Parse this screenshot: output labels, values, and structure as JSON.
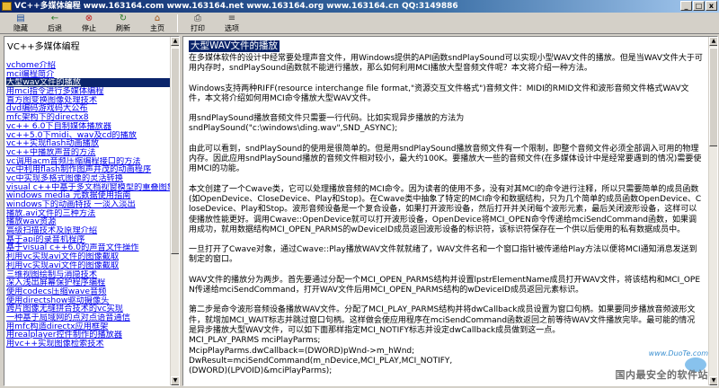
{
  "window": {
    "title": "VC++多媒体编程   www.163164.com  www.163164.net  www.163164.org  www.163164.cn QQ:3149886",
    "min_glyph": "_",
    "max_glyph": "□",
    "close_glyph": "x"
  },
  "toolbar": {
    "items": [
      {
        "label": "隐藏",
        "icon": "hide-icon",
        "glyph": "▤"
      },
      {
        "label": "后退",
        "icon": "back-icon",
        "glyph": "←"
      },
      {
        "label": "停止",
        "icon": "stop-icon",
        "glyph": "⊗"
      },
      {
        "label": "刷新",
        "icon": "refresh-icon",
        "glyph": "↻"
      },
      {
        "label": "主页",
        "icon": "home-icon",
        "glyph": "⌂"
      },
      {
        "label": "打印",
        "icon": "print-icon",
        "glyph": "⎙"
      },
      {
        "label": "选项",
        "icon": "options-icon",
        "glyph": "≡"
      }
    ]
  },
  "sidebar": {
    "title": "VC++多媒体编程",
    "items": [
      "vchome介绍",
      "mci编程简介",
      "大型wav文件的播放",
      "用mci指令进行多媒体编程",
      "直方图变换图像处理技术",
      "dvd编码游戏码大公布",
      "mfc架构下的directx8",
      "vc++ 6.0下自制媒体播放器",
      "vc++5.0下midi、wav及cd的播放",
      "vc++实现flash动画播放",
      "vc++中播放声音的方法",
      "vc调用acm音频压缩编程接口的方法",
      "vc中利用flash制作图声并茂的动画程序",
      "vc中实现多格式图像的灵活转换",
      "visual c++中基于多文档视窗模型的重叠图象",
      "windows media 元数据使用指南",
      "windows下的动画特技 一淡入淡出",
      "播放.avi文件的三种方法",
      "播放wav资源",
      "高级扫描技术及原理介绍",
      "基于api的录音机程序",
      "基于visual c++6.0的声音文件操作",
      "利用vc实现avi文件的图像截取",
      "利用vc实现avi文件的图像截取",
      "三维视图绘制与消隐技术",
      "深入浅出屏幕保护程序编程",
      "使用codecs压缩wave音频",
      "使用directshow驱动摄像头",
      "跨片图像无缝拼合技术的vc实现",
      "一种基于局域网的点对点语音通信",
      "用mfc构造directx应用框架",
      "用realplayer控件制作的播放器",
      "用vc++实现图像检索技术"
    ],
    "active_index": 2
  },
  "article": {
    "title": "大型WAV文件的播放",
    "paragraphs": [
      "在多媒体软件的设计中经常要处理声音文件，用Windows提供的API函数sndPlaySound可以实现小型WAV文件的播放。但是当WAV文件大于可用内存时，sndPlaySound函数就不能进行播放，那么如何利用MCI播放大型音频文件呢？本文将介绍一种方法。",
      "Windows支持两种RIFF(resource interchange file format,\"资源交互文件格式\")音频文件：MIDI的RMID文件和波形音频文件格式WAV文件，本文将介绍如何用MCI命令播放大型WAV文件。",
      "用sndPlaySound播放音频文件只需要一行代码。比如实现异步播放的方法为\nsndPlaySound(\"c:\\windows\\ding.wav\",SND_ASYNC);",
      "由此可以看到，sndPlaySound的使用是很简单的。但是用sndPlaySound播放音频文件有一个限制，即整个音频文件必须全部调入可用的物理内存。因此应用sndPlaySound播放的音频文件相对较小，最大约100K。要播放大一些的音频文件(在多媒体设计中是经常要遇到的情况)需要使用MCI的功能。",
      "本文创建了一个Cwave类，它可以处理播放音频的MCI命令。因为读者的使用不多，没有对其MCI的命令进行注释，所以只需要简单的成员函数(如OpenDevice、CloseDevice、Play和Stop)。在Cwave类中抽象了特定的MCI命令和数据结构，只为几个简单的成员函数OpenDevice、CloseDevice、Play和Stop。波形音频设备是一个复合设备，如果打开波形设备，然后打开并关闭每个波形元素，最后关闭波形设备，这样可以使播放性能更好。调用Cwave::OpenDevice就可以打开波形设备，OpenDevice将MCI_OPEN命令传递给mciSendCommand函数，如果调用成功，就用数据结构MCI_OPEN_PARMS的wDeviceID成员返回波形设备的标识符，该标识符保存在一个供以后使用的私有数据成员中。",
      "一旦打开了Cwave对象，通过Cwave::Play播放WAV文件就就绪了，WAV文件名和一个窗口指针被传递给Play方法以便将MCI通知消息发送到制定的窗口。",
      "WAV文件的播放分为两步。首先要通过分配一个MCI_OPEN_PARMS结构并设置lpstrElementName成员打开WAV文件，将该结构和MCI_OPEN传递给mciSendCommand，打开WAV文件后用MCI_OPEN_PARMS结构的wDeviceID成员返回元素标识。",
      "第二步是命令波形音频设备播放WAV文件。分配了MCI_PLAY_PARMS结构并将dwCallback成员设置为窗口句柄。如果要同步播放音频波形文件，就增加MCI_WAIT标志并跳过窗口句柄。这样做会使应用程序在mciSendCommand函数返回之前等待WAV文件播放完毕。最可能的情况是异步播放大型WAV文件，可以如下面那样指定MCI_NOTIFY标志并设定dwCallback成员做到这一点。"
    ],
    "code": [
      "MCI_PLAY_PARMS mciPlayParms;",
      "McipPlayParms.dwCallback=(DWORD)pWnd->m_hWnd;",
      "DwResult=mciSendCommand(m_nDevice,MCI_PLAY,MCI_NOTIFY,",
      "(DWORD)(LPVOID)&mciPlayParms);"
    ]
  },
  "watermark": {
    "site": "www.DuoTe.com",
    "text": "国内最安全的软件站"
  }
}
